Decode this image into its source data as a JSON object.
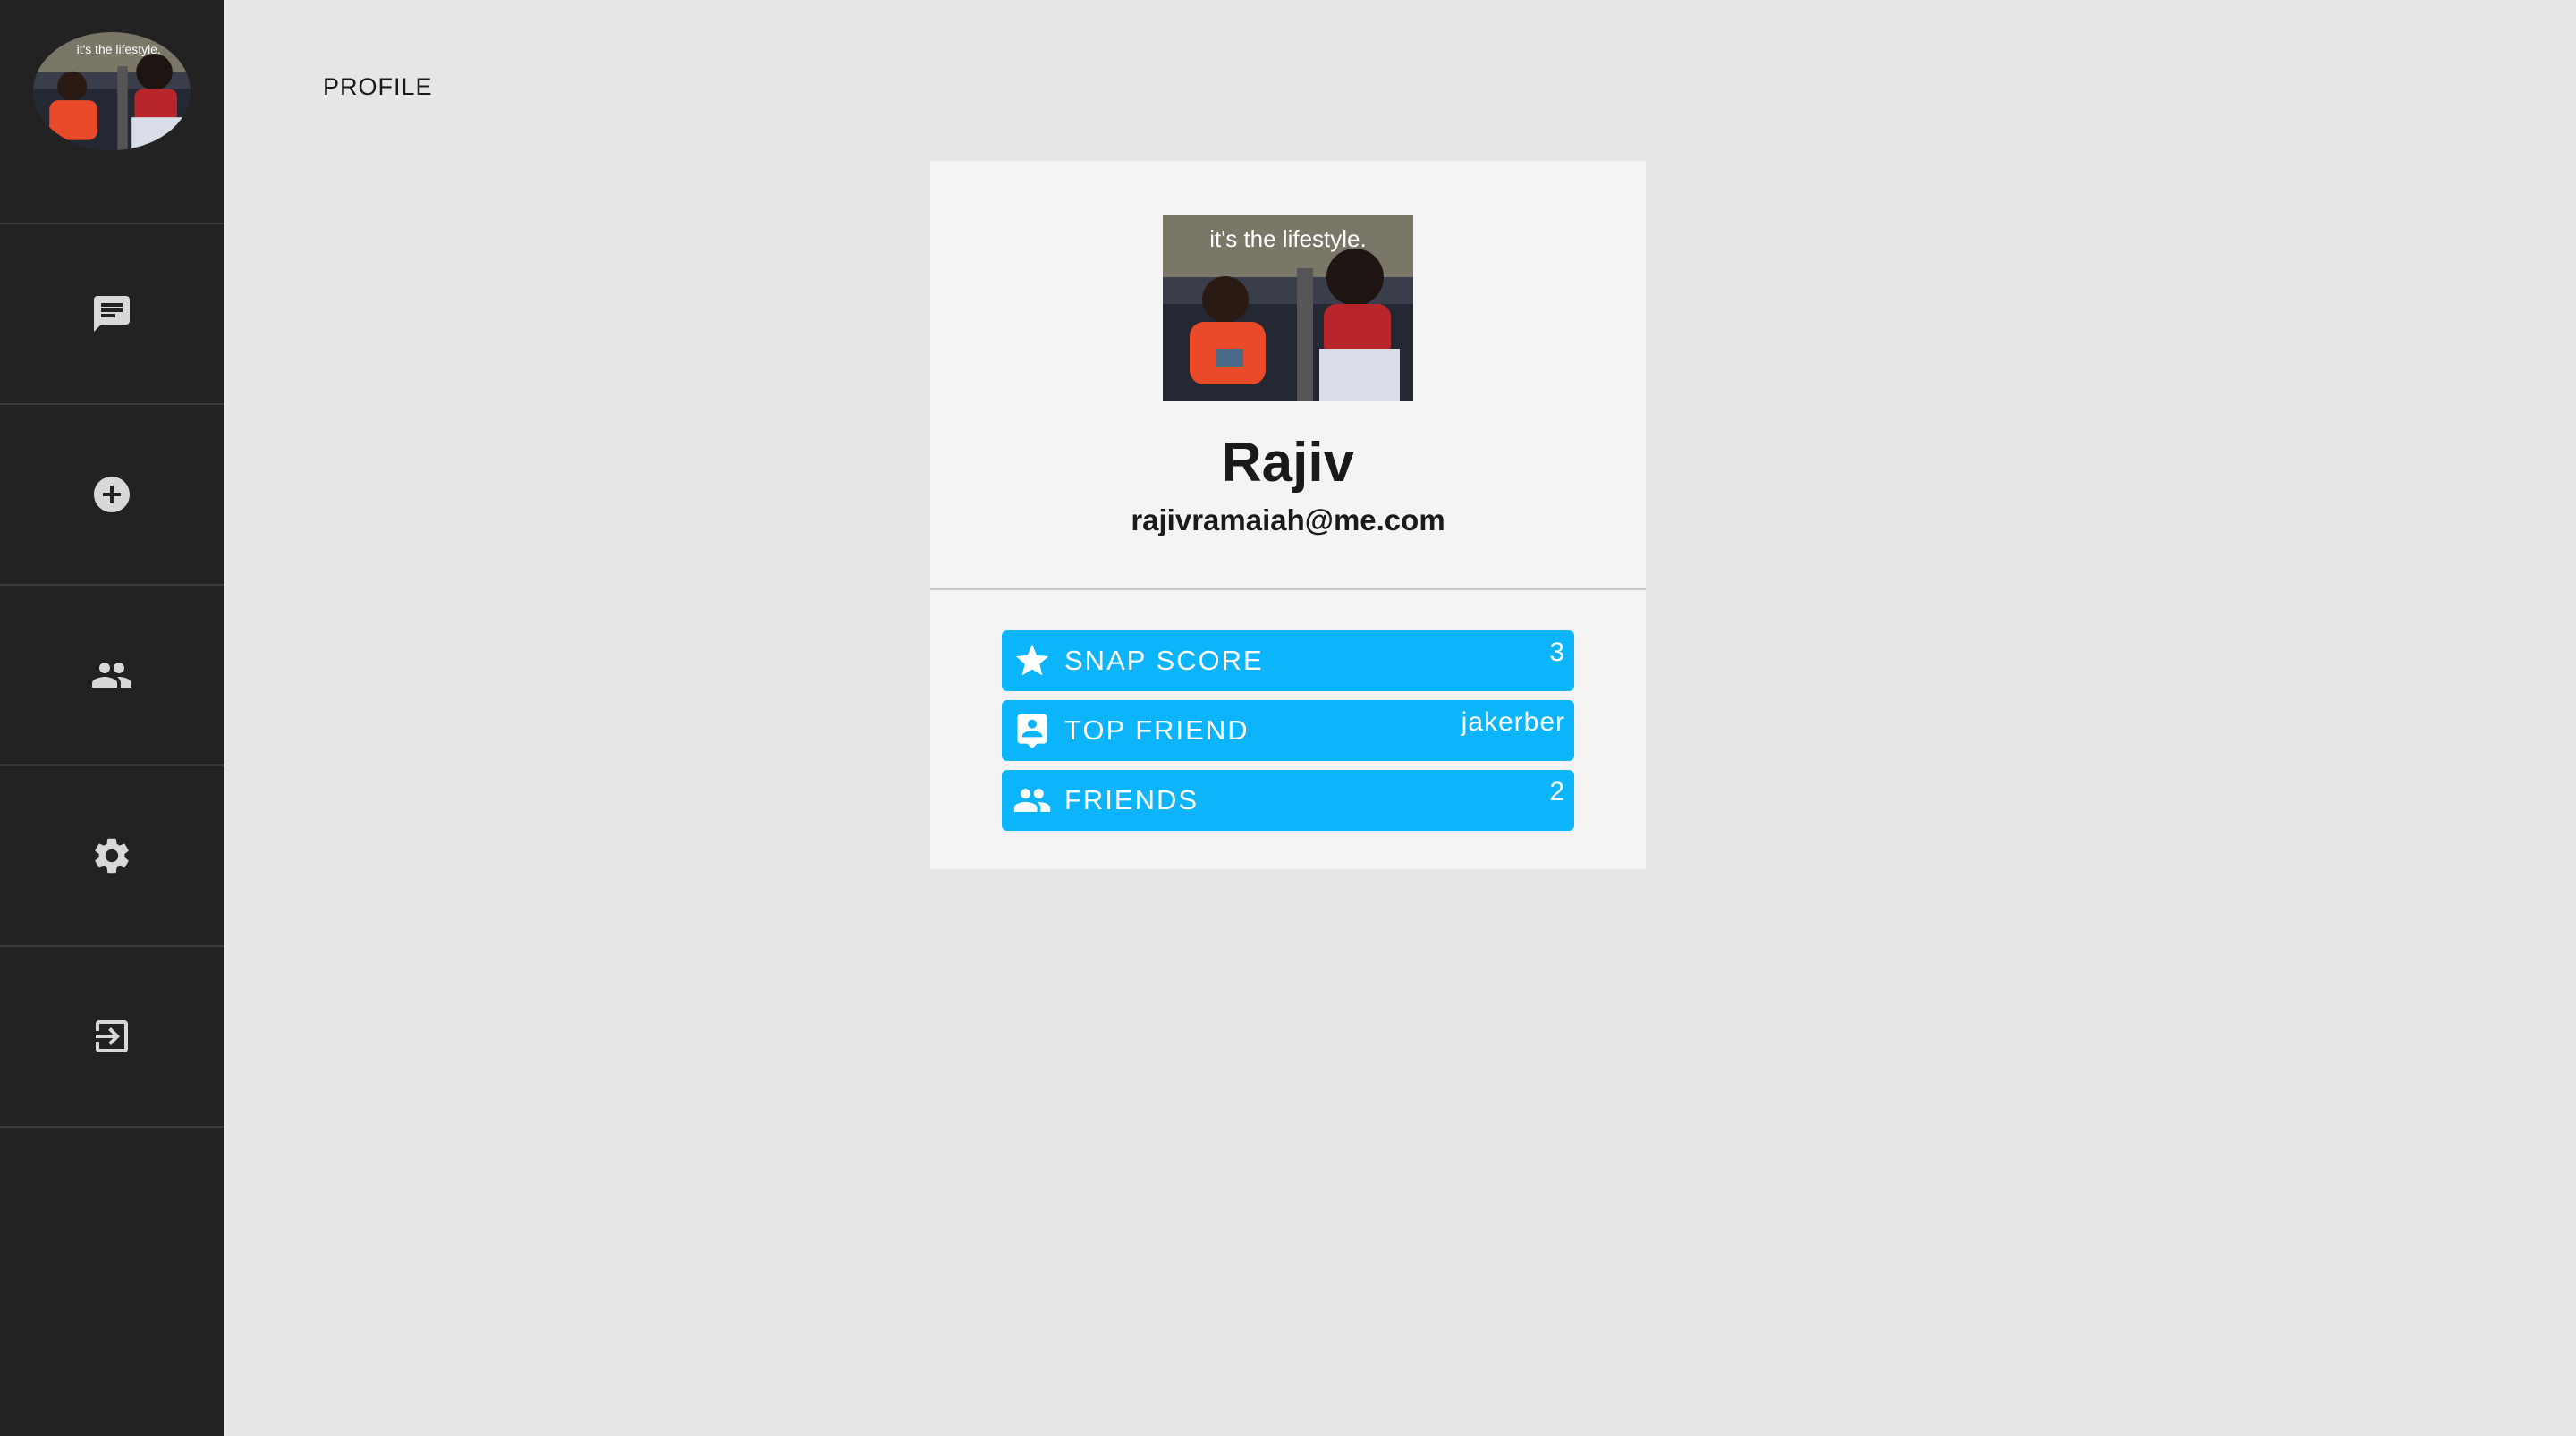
{
  "header": {
    "title": "PROFILE"
  },
  "photo": {
    "caption": "it's the lifestyle."
  },
  "profile": {
    "name": "Rajiv",
    "email": "rajivramaiah@me.com"
  },
  "nav": [
    {
      "icon": "chat-icon"
    },
    {
      "icon": "add-circle-icon"
    },
    {
      "icon": "people-icon"
    },
    {
      "icon": "gear-icon"
    },
    {
      "icon": "logout-icon"
    }
  ],
  "stats": {
    "snap_score": {
      "label": "SNAP SCORE",
      "value": "3",
      "icon": "star-icon"
    },
    "top_friend": {
      "label": "TOP FRIEND",
      "value": "jakerber",
      "icon": "contact-icon"
    },
    "friends": {
      "label": "FRIENDS",
      "value": "2",
      "icon": "people-icon"
    }
  },
  "colors": {
    "sidebar": "#222222",
    "background": "#e6e6e6",
    "card": "#f4f4f4",
    "accent": "#0cb4fb"
  }
}
